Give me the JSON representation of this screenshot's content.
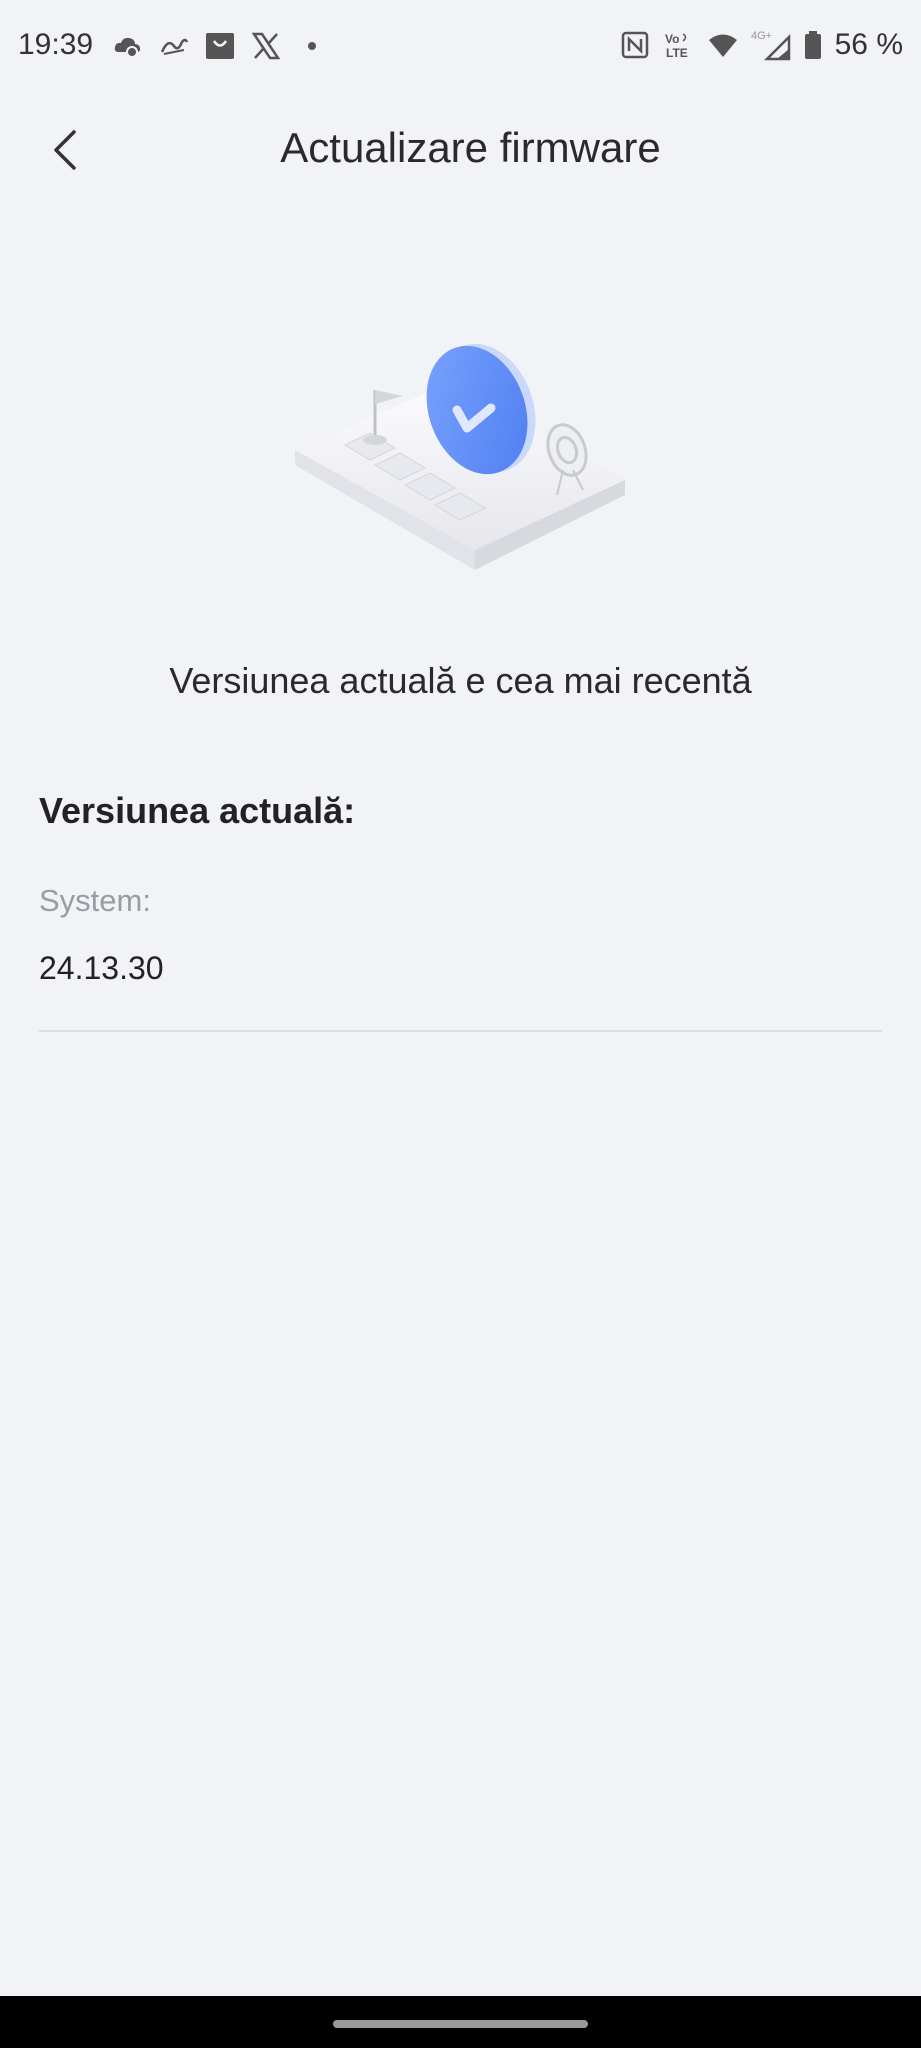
{
  "status_bar": {
    "time": "19:39",
    "battery_percent": "56 %",
    "icons_left": [
      "cloud-app-icon",
      "assistant-app-icon",
      "shop-app-icon",
      "x-app-icon",
      "dot-icon"
    ],
    "icons_right": [
      "nfc-icon",
      "volte-icon",
      "wifi-icon",
      "signal-4g-icon",
      "battery-icon"
    ],
    "signal_label": "4G+",
    "volte_label_top": "Vo",
    "volte_label_bottom": "LTE"
  },
  "header": {
    "title": "Actualizare firmware",
    "back_icon": "chevron-left-icon"
  },
  "main": {
    "status_message": "Versiunea actuală e cea mai recentă",
    "section_heading": "Versiunea actuală:",
    "system_label": "System:",
    "system_value": "24.13.30"
  },
  "colors": {
    "background": "#f2f3f7",
    "accent_blue": "#5b8cf5",
    "secondary_text": "#9a9ca3"
  }
}
